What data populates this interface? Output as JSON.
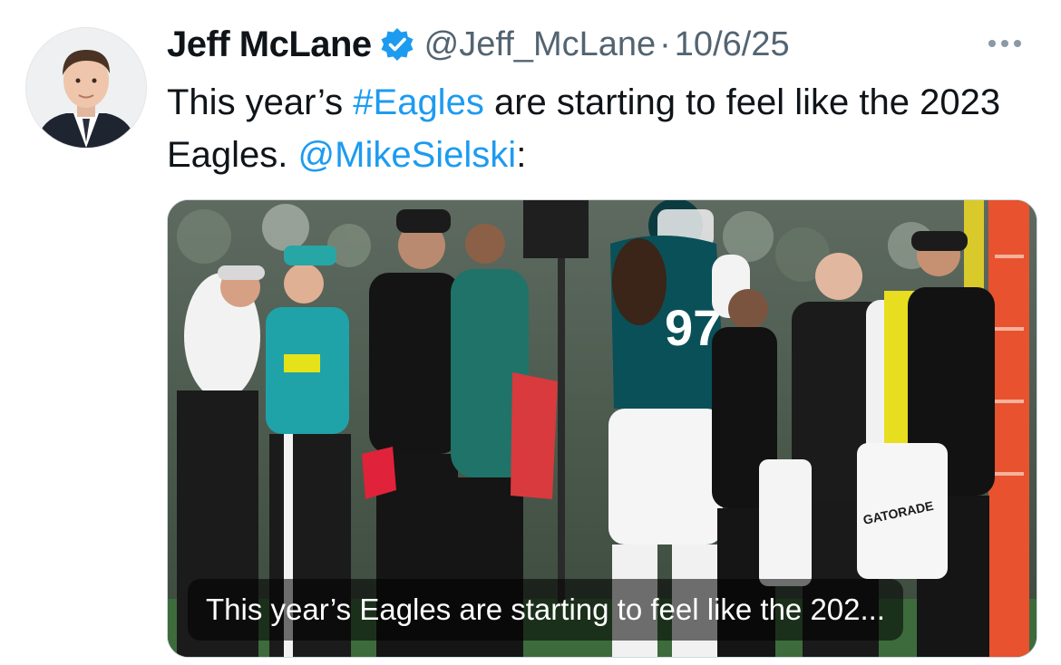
{
  "tweet": {
    "author_name": "Jeff McLane",
    "handle": "@Jeff_McLane",
    "separator": "·",
    "date": "10/6/25",
    "text_part1": "This year’s ",
    "hashtag": "#Eagles",
    "text_part2": " are starting to feel like the 2023 Eagles. ",
    "mention": "@MikeSielski",
    "text_part3": ":",
    "media_caption": "This year’s Eagles are starting to feel like the 202...",
    "jersey_number": "97",
    "towel_brand": "GATORADE"
  },
  "icons": {
    "verified": "verified-badge-icon",
    "more": "more-options-icon"
  },
  "colors": {
    "link": "#1d9bf0",
    "verified": "#1d9bf0",
    "secondary_text": "#536471",
    "eagles_green": "#004c54"
  }
}
